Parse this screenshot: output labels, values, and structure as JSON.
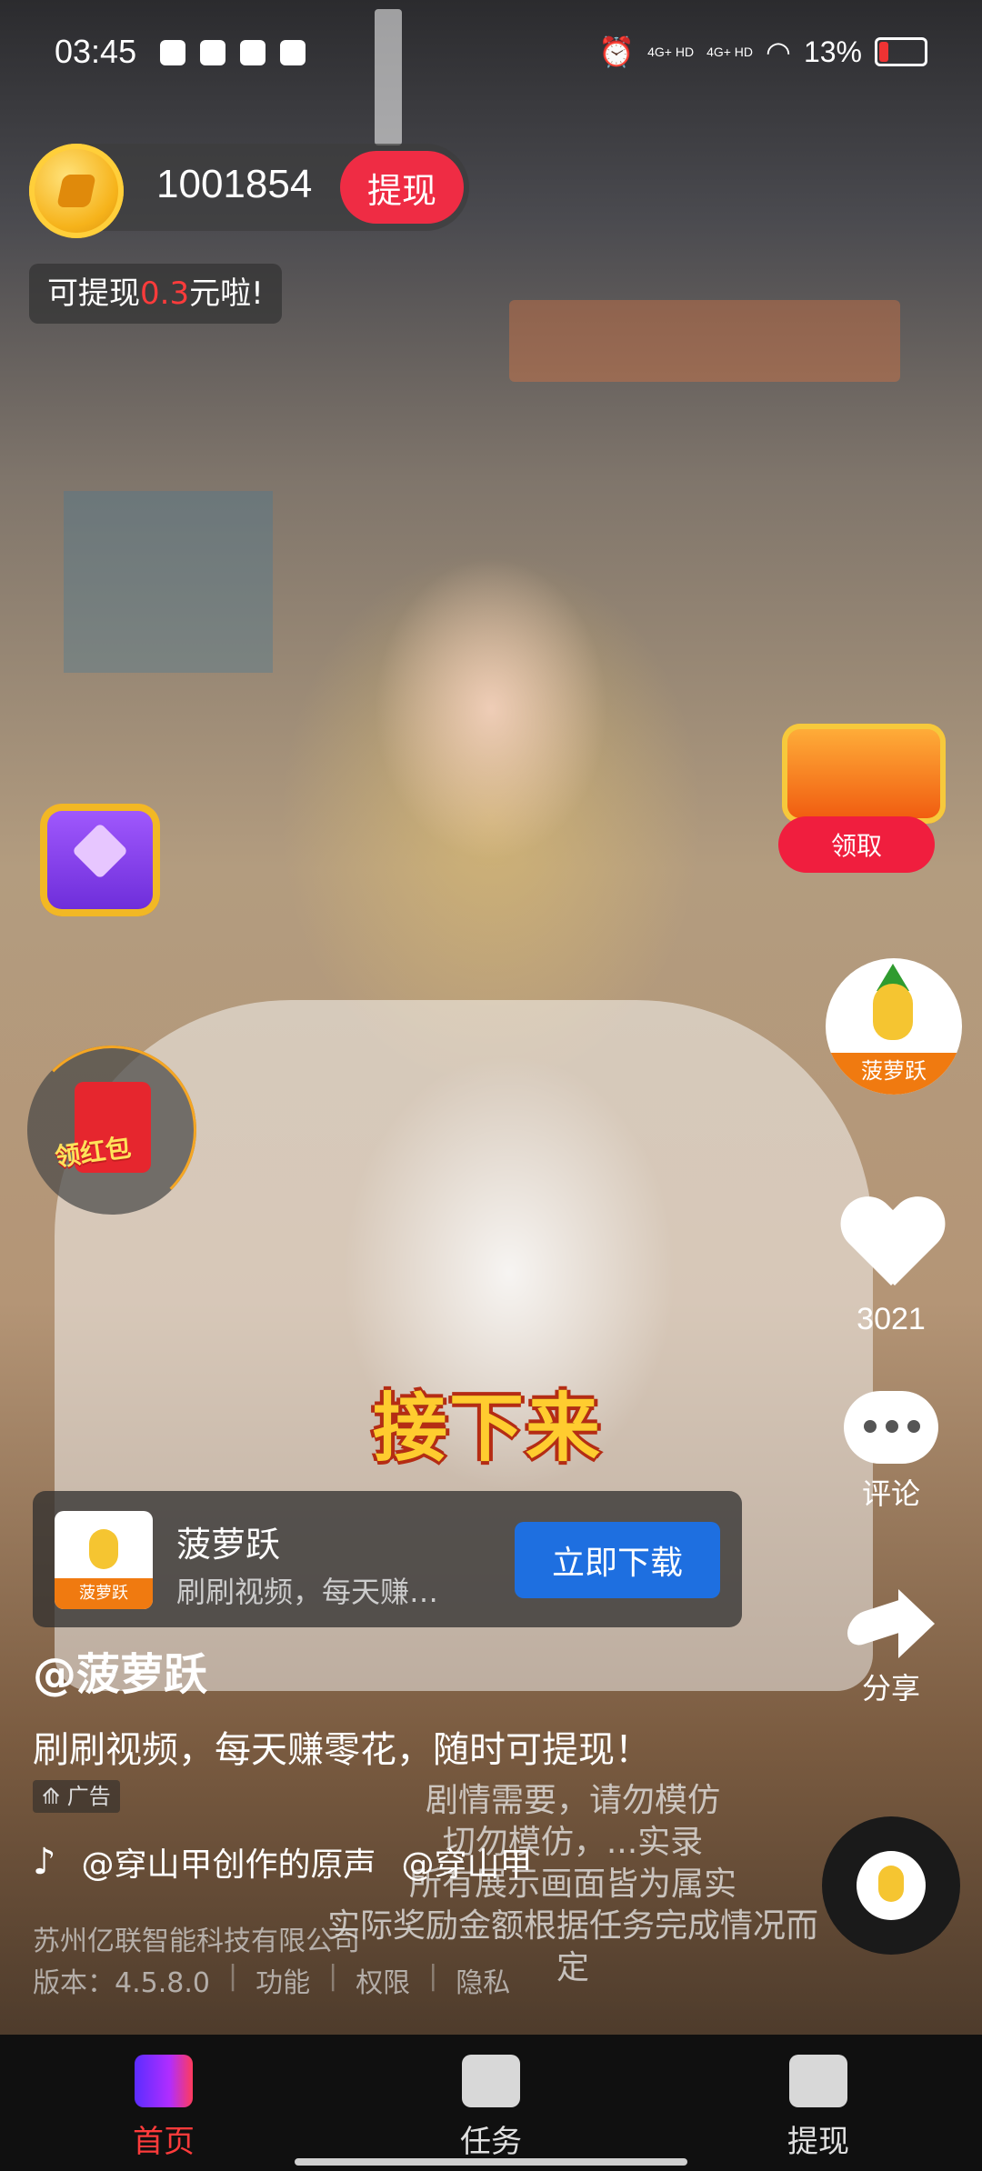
{
  "status_bar": {
    "time": "03:45",
    "network_1": "4G+ HD",
    "network_2": "4G+ HD",
    "battery": "13%"
  },
  "coins": {
    "count": "1001854",
    "withdraw_label": "提现",
    "tip_prefix": "可提现",
    "tip_amount": "0.3",
    "tip_suffix": "元啦!"
  },
  "widgets": {
    "red_packet_label": "领红包",
    "claim_label": "领取",
    "avatar_label": "菠萝跃"
  },
  "actions": {
    "like_count": "3021",
    "comment_label": "评论",
    "share_label": "分享"
  },
  "ad_card": {
    "logo_label": "菠萝跃",
    "name": "菠萝跃",
    "subtitle": "刷刷视频，每天赚…",
    "download_label": "立即下载"
  },
  "video": {
    "caption": "接下来",
    "username": "@菠萝跃",
    "description": "刷刷视频，每天赚零花，随时可提现！",
    "ad_tag": "广告",
    "music": "@穿山甲创作的原声",
    "music_author": "@穿山甲",
    "watermark_1": "剧情需要，请勿模仿",
    "watermark_2": "切勿模仿，...实录",
    "watermark_3": "所有展示画面皆为属实",
    "watermark_4": "实际奖励金额根据任务完成情况而定",
    "company": "苏州亿联智能科技有限公司",
    "version": "版本：4.5.8.0",
    "link_features": "功能",
    "link_permissions": "权限",
    "link_privacy": "隐私"
  },
  "nav": {
    "home": "首页",
    "tasks": "任务",
    "withdraw": "提现",
    "active_color": "#ff3b3b"
  }
}
